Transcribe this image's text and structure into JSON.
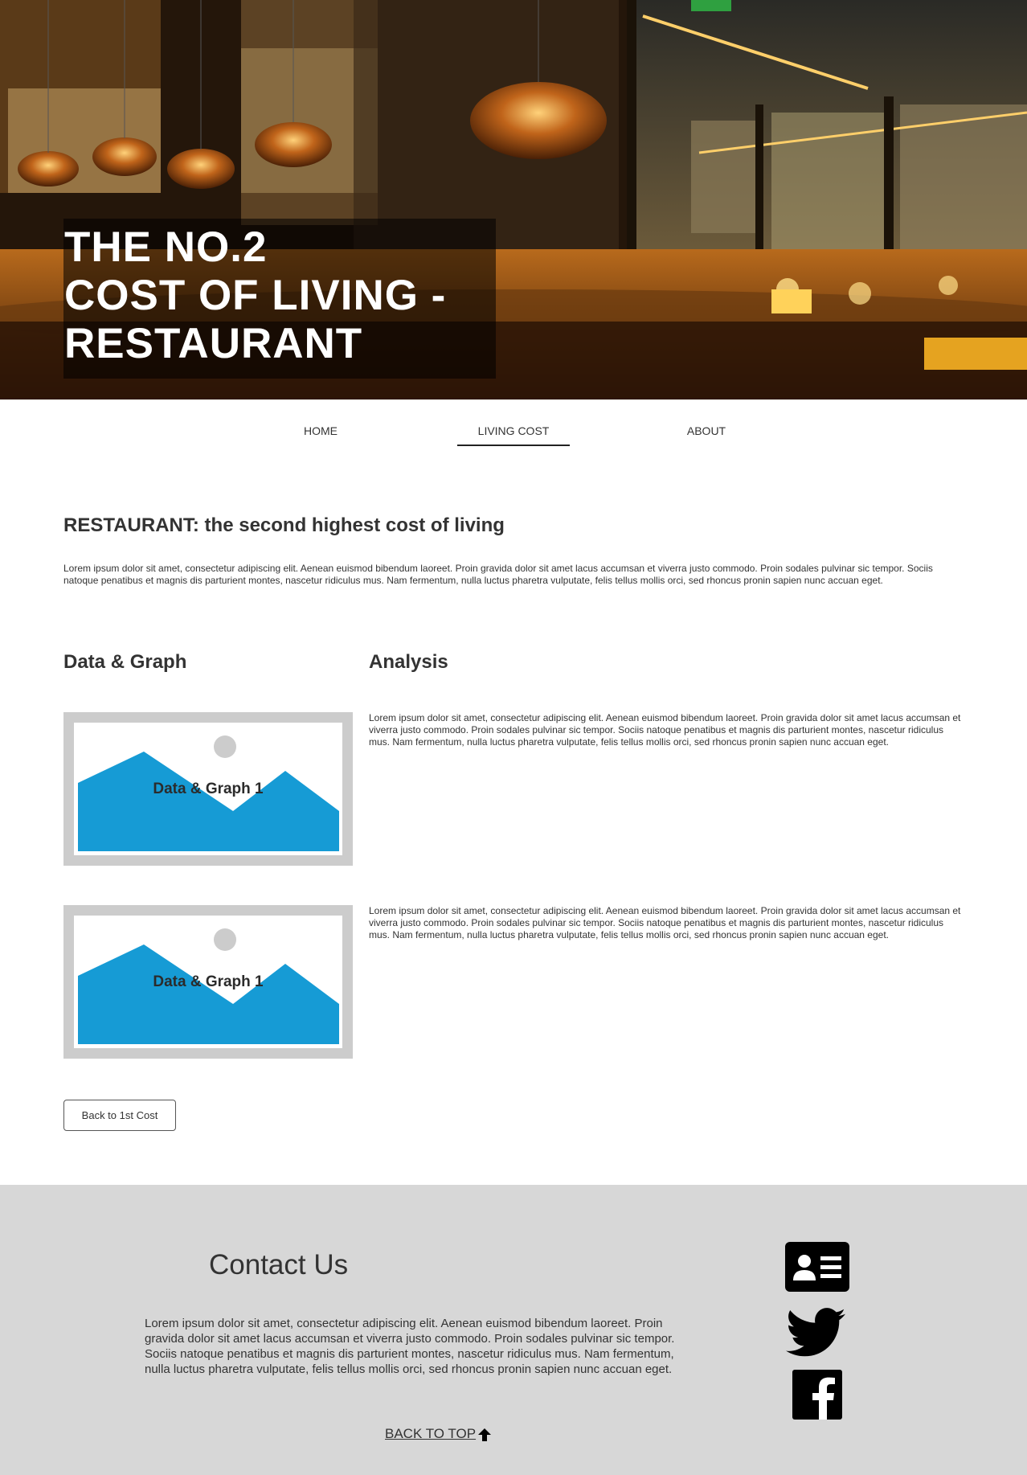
{
  "hero": {
    "title_lines": [
      "THE NO.2",
      "COST OF LIVING -",
      "RESTAURANT"
    ]
  },
  "nav": {
    "items": [
      {
        "label": "HOME"
      },
      {
        "label": "LIVING COST",
        "active": true
      },
      {
        "label": "ABOUT"
      }
    ]
  },
  "main": {
    "heading": "RESTAURANT: the second highest cost of living",
    "intro": "Lorem ipsum dolor sit amet, consectetur adipiscing elit. Aenean euismod bibendum laoreet. Proin gravida dolor sit amet lacus accumsan et viverra justo commodo. Proin sodales pulvinar sic tempor. Sociis natoque penatibus et magnis dis parturient montes, nascetur ridiculus mus. Nam fermentum, nulla luctus pharetra vulputate, felis tellus mollis orci, sed rhoncus pronin sapien nunc accuan eget.",
    "data_heading": "Data & Graph",
    "analysis_heading": "Analysis",
    "graphs": [
      {
        "label": "Data & Graph 1",
        "analysis": "Lorem ipsum dolor sit amet, consectetur adipiscing elit. Aenean euismod bibendum laoreet. Proin gravida dolor sit amet lacus accumsan et viverra justo commodo. Proin sodales pulvinar sic tempor. Sociis natoque penatibus et magnis dis parturient montes, nascetur ridiculus mus. Nam fermentum, nulla luctus pharetra vulputate, felis tellus mollis orci, sed rhoncus pronin sapien nunc accuan eget."
      },
      {
        "label": "Data & Graph 1",
        "analysis": "Lorem ipsum dolor sit amet, consectetur adipiscing elit. Aenean euismod bibendum laoreet. Proin gravida dolor sit amet lacus accumsan et viverra justo commodo. Proin sodales pulvinar sic tempor. Sociis natoque penatibus et magnis dis parturient montes, nascetur ridiculus mus. Nam fermentum, nulla luctus pharetra vulputate, felis tellus mollis orci, sed rhoncus pronin sapien nunc accuan eget."
      }
    ],
    "back_button": "Back to 1st Cost",
    "placeholder_colors": {
      "mountain": "#169bd5",
      "sun": "#cccccc",
      "frame": "#cccccc"
    }
  },
  "footer": {
    "contact_title": "Contact Us",
    "contact_text": "Lorem ipsum dolor sit amet, consectetur adipiscing elit. Aenean euismod bibendum laoreet. Proin gravida dolor sit amet lacus accumsan et viverra justo commodo. Proin sodales pulvinar sic tempor. Sociis natoque penatibus et magnis dis parturient montes, nascetur ridiculus mus. Nam fermentum, nulla luctus pharetra vulputate, felis tellus mollis orci, sed rhoncus pronin sapien nunc accuan eget.",
    "back_to_top": "BACK TO TOP",
    "social_icons": [
      "contact-card-icon",
      "twitter-icon",
      "facebook-icon"
    ]
  }
}
